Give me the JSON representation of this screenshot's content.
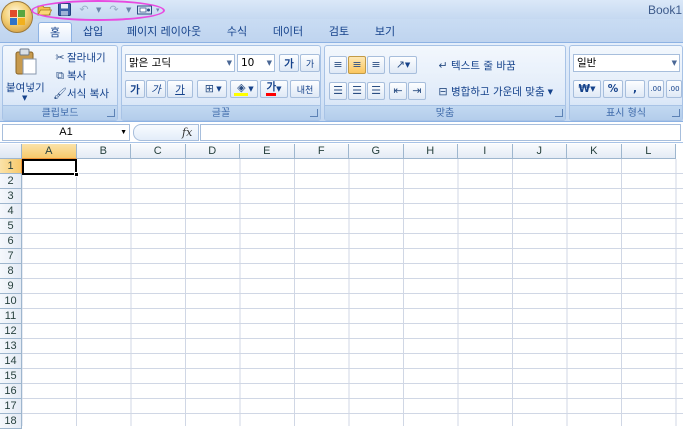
{
  "window": {
    "title": "Book1"
  },
  "qat": {
    "icons": [
      "folder-open-icon",
      "save-icon",
      "undo-icon",
      "redo-icon",
      "print-preview-icon",
      "customize-icon"
    ]
  },
  "tabs": [
    {
      "label": "홈",
      "active": true
    },
    {
      "label": "삽입"
    },
    {
      "label": "페이지 레이아웃"
    },
    {
      "label": "수식"
    },
    {
      "label": "데이터"
    },
    {
      "label": "검토"
    },
    {
      "label": "보기"
    }
  ],
  "ribbon": {
    "clipboard": {
      "label": "클립보드",
      "paste": "붙여넣기",
      "cut": "잘라내기",
      "copy": "복사",
      "format_painter": "서식 복사"
    },
    "font": {
      "label": "글꼴",
      "font_name": "맑은 고딕",
      "font_size": "10",
      "grow": "가",
      "shrink": "가",
      "bold": "가",
      "italic": "가",
      "underline": "가",
      "font_color_glyph": "가",
      "phonetic": "내천"
    },
    "alignment": {
      "label": "맞춤",
      "wrap_text": "텍스트 줄 바꿈",
      "merge_center": "병합하고 가운데 맞춤"
    },
    "number": {
      "label": "표시 형식",
      "format": "일반",
      "currency": "₩",
      "percent": "%",
      "comma": ",",
      "inc_decimal": ".00",
      "dec_decimal": ".00"
    },
    "colors": {
      "fill": "#ffff00",
      "font": "#ff0000"
    }
  },
  "formula_bar": {
    "name_box": "A1",
    "fx": "fx",
    "value": ""
  },
  "grid": {
    "columns": [
      "A",
      "B",
      "C",
      "D",
      "E",
      "F",
      "G",
      "H",
      "I",
      "J",
      "K",
      "L"
    ],
    "rows": [
      "1",
      "2",
      "3",
      "4",
      "5",
      "6",
      "7",
      "8",
      "9",
      "10",
      "11",
      "12",
      "13",
      "14",
      "15",
      "16",
      "17",
      "18"
    ],
    "active_cell": "A1"
  }
}
